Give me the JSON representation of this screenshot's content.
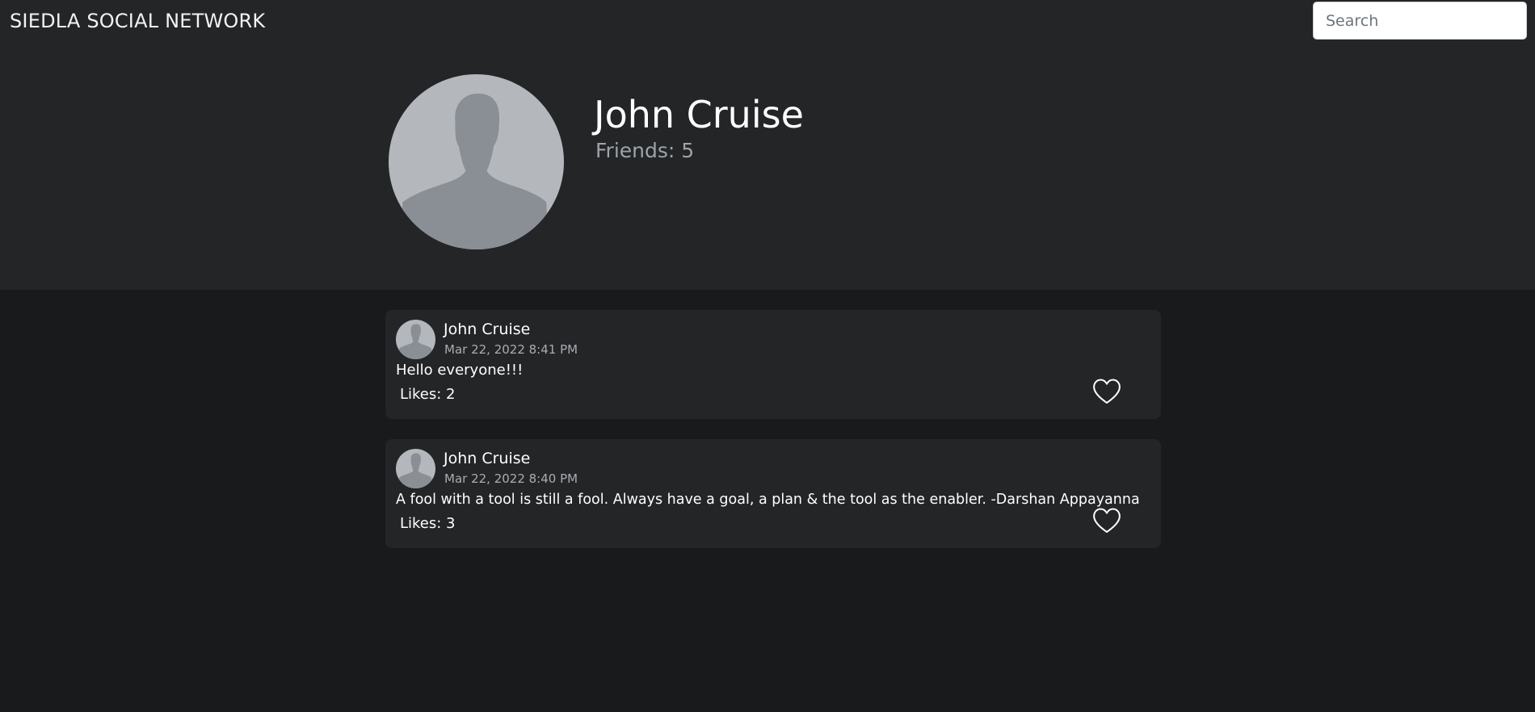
{
  "navbar": {
    "brand": "SIEDLA SOCIAL NETWORK",
    "search_placeholder": "Search"
  },
  "profile": {
    "name": "John Cruise",
    "friends_text": "Friends: 5"
  },
  "posts": [
    {
      "author": "John Cruise",
      "timestamp": "Mar 22, 2022 8:41 PM",
      "text": "Hello everyone!!!",
      "likes_text": "Likes: 2"
    },
    {
      "author": "John Cruise",
      "timestamp": "Mar 22, 2022 8:40 PM",
      "text": "A fool with a tool is still a fool. Always have a goal, a plan & the tool as the enabler. -Darshan Appayanna",
      "likes_text": "Likes: 3"
    }
  ],
  "icons": {
    "avatar": "default-user-silhouette-icon",
    "like": "heart-outline-icon"
  },
  "colors": {
    "page_background": "#191a1c",
    "card_background": "#232527",
    "muted_text": "#9da3a9",
    "avatar_background": "#b4b8bd",
    "avatar_silhouette": "#8a8f95"
  }
}
